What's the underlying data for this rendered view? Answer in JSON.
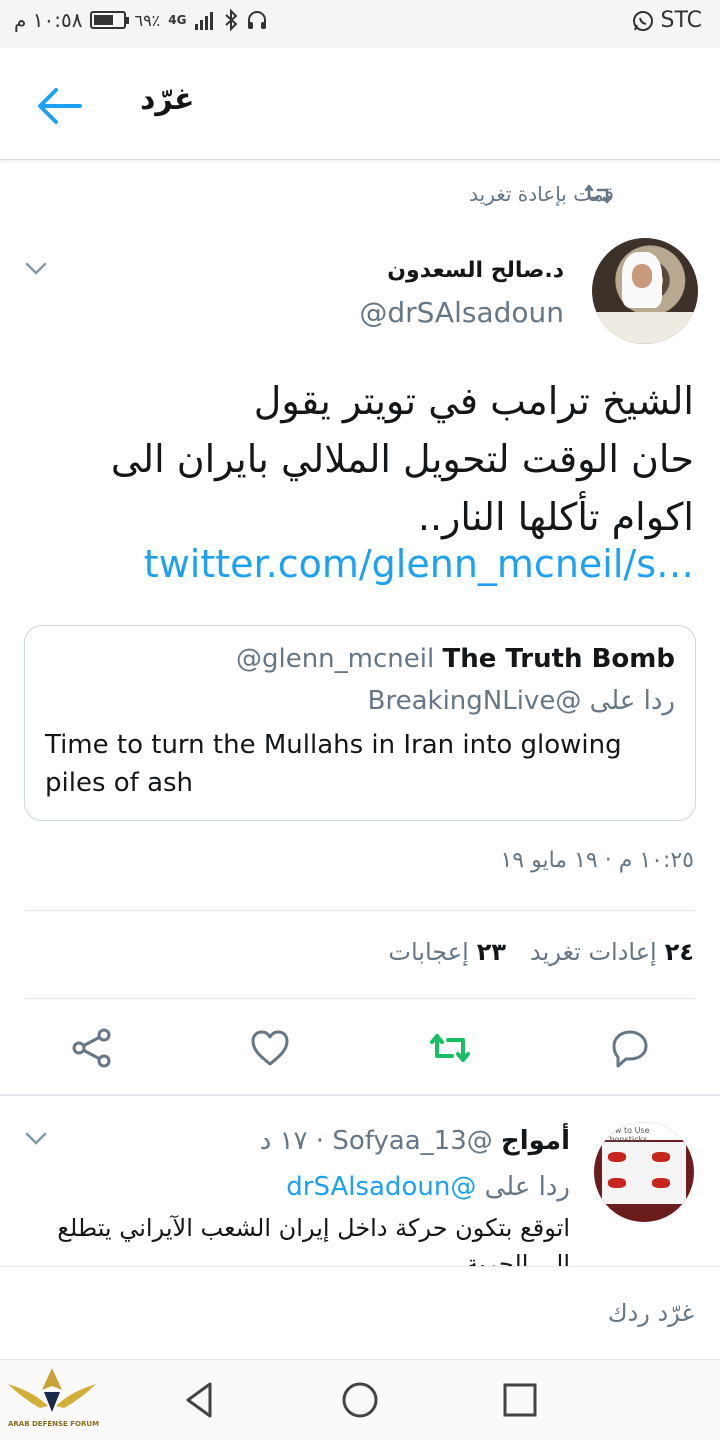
{
  "status_bar": {
    "time": "١٠:٥٨ م",
    "battery": "٦٩٪",
    "battery_level": 0.69,
    "network": "4G",
    "carrier": "STC"
  },
  "header": {
    "title": "غرّد"
  },
  "retweet_context": "قمت بإعادة تغريد",
  "tweet": {
    "author_name": "د.صالح السعدون",
    "author_handle": "@drSAlsadoun",
    "text_lines": [
      "الشيخ ترامب في تويتر يقول",
      "حان الوقت لتحويل الملالي بايران الى",
      "اكوام تأكلها النار.."
    ],
    "link": "twitter.com/glenn_mcneil/s…",
    "timestamp": "١٠:٢٥ م · ١٩ مايو ١٩",
    "retweets_count": "٢٤",
    "retweets_label": "إعادات تغريد",
    "likes_count": "٢٣",
    "likes_label": "إعجابات"
  },
  "quote": {
    "name": "The Truth Bomb",
    "handle": "@glenn_mcneil",
    "reply_label": "ردا على",
    "reply_handle": "@BreakingNLive",
    "text": "Time to turn the Mullahs in Iran into glowing piles of ash"
  },
  "reply": {
    "name": "أمواج",
    "handle": "@Sofyaa_13",
    "time": "· ١٧ د",
    "reply_label": "ردا على",
    "reply_handle": "@drSAlsadoun",
    "text": "اتوقع بتكون حركة داخل إيران  الشعب الآيراني يتطلع الى الحرية",
    "avatar_caption": "How to Use Chopsticks"
  },
  "compose": {
    "placeholder": "غرّد ردك"
  },
  "watermark": {
    "logo_text": "ARAB DEFENSE FORUM"
  },
  "colors": {
    "accent": "#1da1f2",
    "retweet_green": "#17bf63",
    "muted": "#657786"
  }
}
